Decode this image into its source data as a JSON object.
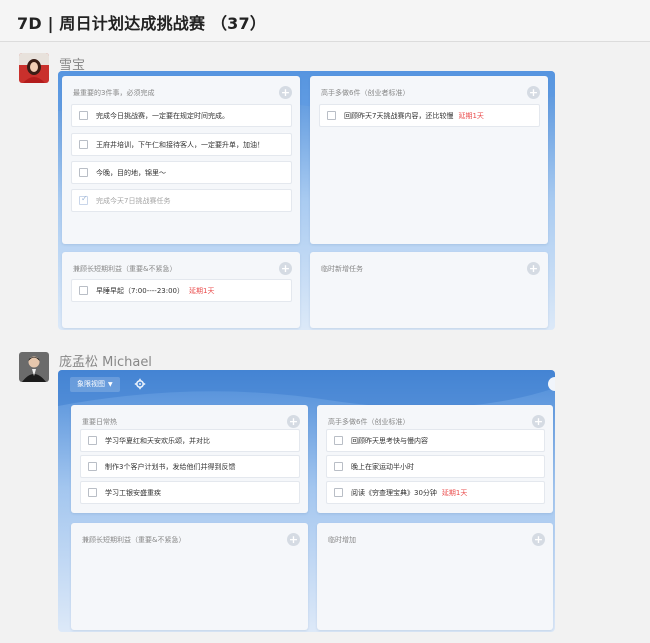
{
  "header": {
    "title": "7D | 周日计划达成挑战赛 （37）"
  },
  "users": [
    {
      "name": "雪宝",
      "quadrants": [
        {
          "title": "最重要的3件事，必须完成",
          "tasks": [
            {
              "text": "完成今日挑战赛，一定要在规定时间完成。",
              "done": false,
              "overdue": ""
            },
            {
              "text": "王府井培训，下午仁和接待客人，一定要升单，加油！",
              "done": false,
              "overdue": ""
            },
            {
              "text": "今晚，目的地，锦里～",
              "done": false,
              "overdue": ""
            },
            {
              "text": "完成今天7日挑战赛任务",
              "done": true,
              "overdue": ""
            }
          ]
        },
        {
          "title": "高手多做6件（创业者标准）",
          "tasks": [
            {
              "text": "回顾昨天7天挑战赛内容，还比较慢",
              "done": false,
              "overdue": "延期1天"
            }
          ]
        },
        {
          "title": "兼顾长短期利益（重要&不紧急）",
          "tasks": [
            {
              "text": "早睡早起（7:00----23:00）",
              "done": false,
              "overdue": "延期1天"
            }
          ]
        },
        {
          "title": "临时新增任务",
          "tasks": []
        }
      ]
    },
    {
      "name": "庞孟松 Michael",
      "view_label": "象限视图",
      "quadrants": [
        {
          "title": "重要日常热",
          "tasks": [
            {
              "text": "学习华夏红和天安欢乐颂，并对比",
              "done": false,
              "overdue": ""
            },
            {
              "text": "制作3个客户计划书，发给他们并得到反馈",
              "done": false,
              "overdue": ""
            },
            {
              "text": "学习工银安盛重疾",
              "done": false,
              "overdue": ""
            }
          ]
        },
        {
          "title": "高手多做6件（创业标准）",
          "tasks": [
            {
              "text": "回顾昨天思考快与慢内容",
              "done": false,
              "overdue": ""
            },
            {
              "text": "晚上在家运动半小时",
              "done": false,
              "overdue": ""
            },
            {
              "text": "阅读《穷查理宝典》30分钟",
              "done": false,
              "overdue": "延期1天"
            }
          ]
        },
        {
          "title": "兼顾长短期利益（重要&不紧急）",
          "tasks": []
        },
        {
          "title": "临时增加",
          "tasks": []
        }
      ]
    }
  ]
}
